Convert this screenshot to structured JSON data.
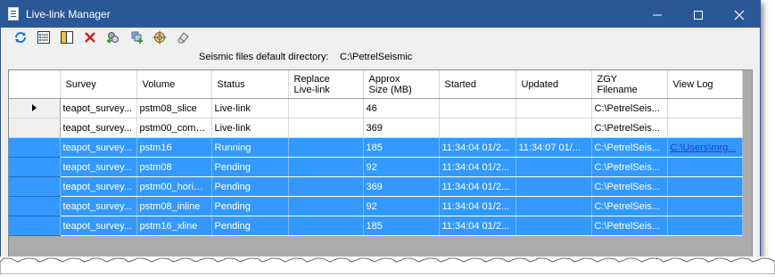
{
  "window": {
    "title": "Live-link Manager"
  },
  "toolbar": {
    "buttons": [
      {
        "name": "refresh-icon"
      },
      {
        "name": "list-details-icon"
      },
      {
        "name": "panel-icon"
      },
      {
        "name": "delete-icon"
      },
      {
        "name": "add-link-icon"
      },
      {
        "name": "add-items-icon"
      },
      {
        "name": "target-icon"
      },
      {
        "name": "eraser-icon"
      }
    ]
  },
  "directory": {
    "label": "Seismic files default directory:",
    "value": "C:\\PetrelSeismic"
  },
  "table": {
    "columns": [
      "Survey",
      "Volume",
      "Status",
      "Replace\nLive-link",
      "Approx\nSize (MB)",
      "Started",
      "Updated",
      "ZGY\nFilename",
      "View Log"
    ],
    "rows": [
      {
        "selected": false,
        "current": true,
        "cells": [
          "teapot_survey...",
          "pstm08_slice",
          "Live-link",
          "",
          "46",
          "",
          "",
          "C:\\PetrelSeis...",
          ""
        ]
      },
      {
        "selected": false,
        "current": false,
        "cells": [
          "teapot_survey...",
          "pstm00_comp...",
          "Live-link",
          "",
          "369",
          "",
          "",
          "C:\\PetrelSeis...",
          ""
        ]
      },
      {
        "selected": true,
        "current": false,
        "cells": [
          "teapot_survey...",
          "pstm16",
          "Running",
          "",
          "185",
          "11:34:04 01/2...",
          "11:34:07 01/...",
          "C:\\PetrelSeis...",
          "C:\\Users\\mrg..."
        ]
      },
      {
        "selected": true,
        "current": false,
        "cells": [
          "teapot_survey...",
          "pstm08",
          "Pending",
          "",
          "92",
          "11:34:04 01/2...",
          "",
          "C:\\PetrelSeis...",
          ""
        ]
      },
      {
        "selected": true,
        "current": false,
        "cells": [
          "teapot_survey...",
          "pstm00_horizo...",
          "Pending",
          "",
          "369",
          "11:34:04 01/2...",
          "",
          "C:\\PetrelSeis...",
          ""
        ]
      },
      {
        "selected": true,
        "current": false,
        "cells": [
          "teapot_survey...",
          "pstm08_inline",
          "Pending",
          "",
          "92",
          "11:34:04 01/2...",
          "",
          "C:\\PetrelSeis...",
          ""
        ]
      },
      {
        "selected": true,
        "current": false,
        "cells": [
          "teapot_survey...",
          "pstm16_xline",
          "Pending",
          "",
          "185",
          "11:34:04 01/2...",
          "",
          "C:\\PetrelSeis...",
          ""
        ]
      }
    ]
  },
  "colors": {
    "titlebar": "#2b5797",
    "selection": "#3399ff",
    "link": "#1e3fbf"
  }
}
